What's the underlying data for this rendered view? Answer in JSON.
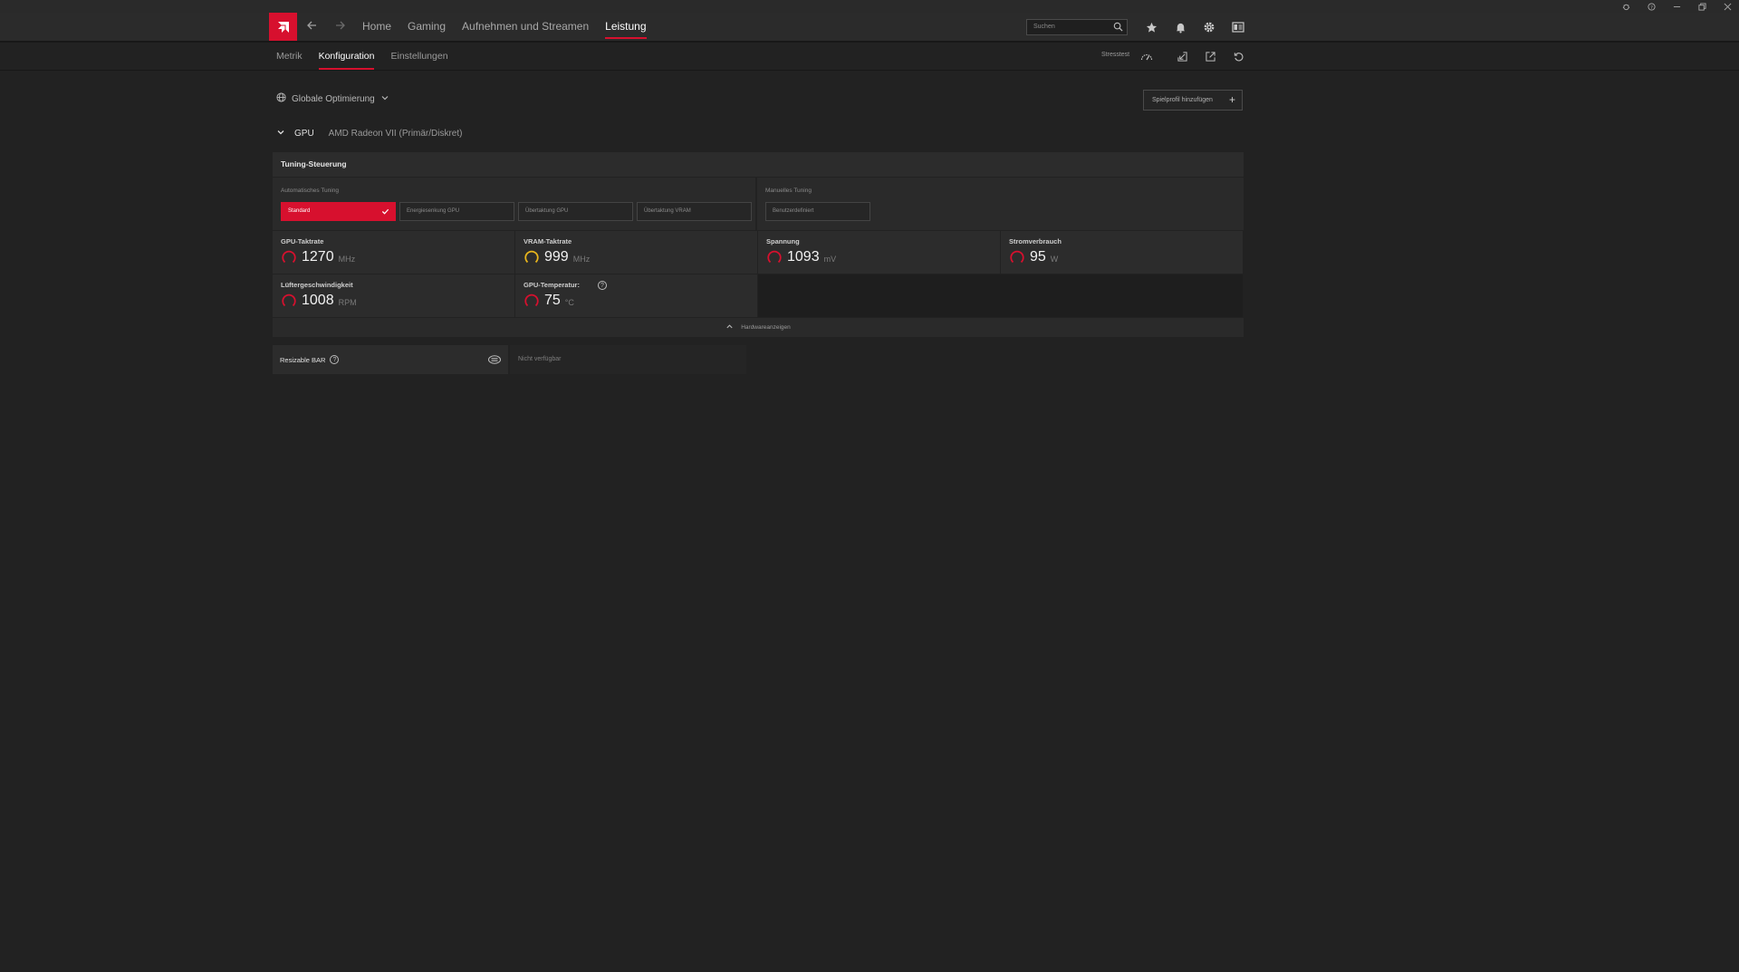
{
  "nav": {
    "links": [
      "Home",
      "Gaming",
      "Aufnehmen und Streamen",
      "Leistung"
    ],
    "active": "Leistung",
    "search_placeholder": "Suchen"
  },
  "subnav": {
    "tabs": [
      "Metrik",
      "Konfiguration",
      "Einstellungen"
    ],
    "active": "Konfiguration",
    "stresstest_label": "Stresstest"
  },
  "profile": {
    "selector": "Globale Optimierung",
    "add_button": "Spielprofil hinzufügen"
  },
  "gpu": {
    "label": "GPU",
    "name": "AMD Radeon VII (Primär/Diskret)"
  },
  "tuning": {
    "title": "Tuning-Steuerung",
    "auto_label": "Automatisches Tuning",
    "auto_options": [
      "Standard",
      "Energiesenkung GPU",
      "Übertaktung GPU",
      "Übertaktung VRAM"
    ],
    "selected": "Standard",
    "manual_label": "Manuelles Tuning",
    "manual_options": [
      "Benutzerdefiniert"
    ]
  },
  "metrics": [
    {
      "title": "GPU-Taktrate",
      "value": "1270",
      "unit": "MHz",
      "gauge_color": "#d7102e"
    },
    {
      "title": "VRAM-Taktrate",
      "value": "999",
      "unit": "MHz",
      "gauge_color": "#e8b51c"
    },
    {
      "title": "Spannung",
      "value": "1093",
      "unit": "mV",
      "gauge_color": "#d7102e"
    },
    {
      "title": "Stromverbrauch",
      "value": "95",
      "unit": "W",
      "gauge_color": "#d7102e"
    },
    {
      "title": "Lüftergeschwindigkeit",
      "value": "1008",
      "unit": "RPM",
      "gauge_color": "#d7102e"
    },
    {
      "title": "GPU-Temperatur:",
      "value": "75",
      "unit": "°C",
      "gauge_color": "#d7102e"
    }
  ],
  "hardware_toggle": "Hardwareanzeigen",
  "resizable_bar": {
    "label": "Resizable BAR",
    "status": "Nicht verfügbar"
  },
  "colors": {
    "accent": "#d7102e",
    "background": "#222222",
    "panel": "#2c2c2c"
  }
}
